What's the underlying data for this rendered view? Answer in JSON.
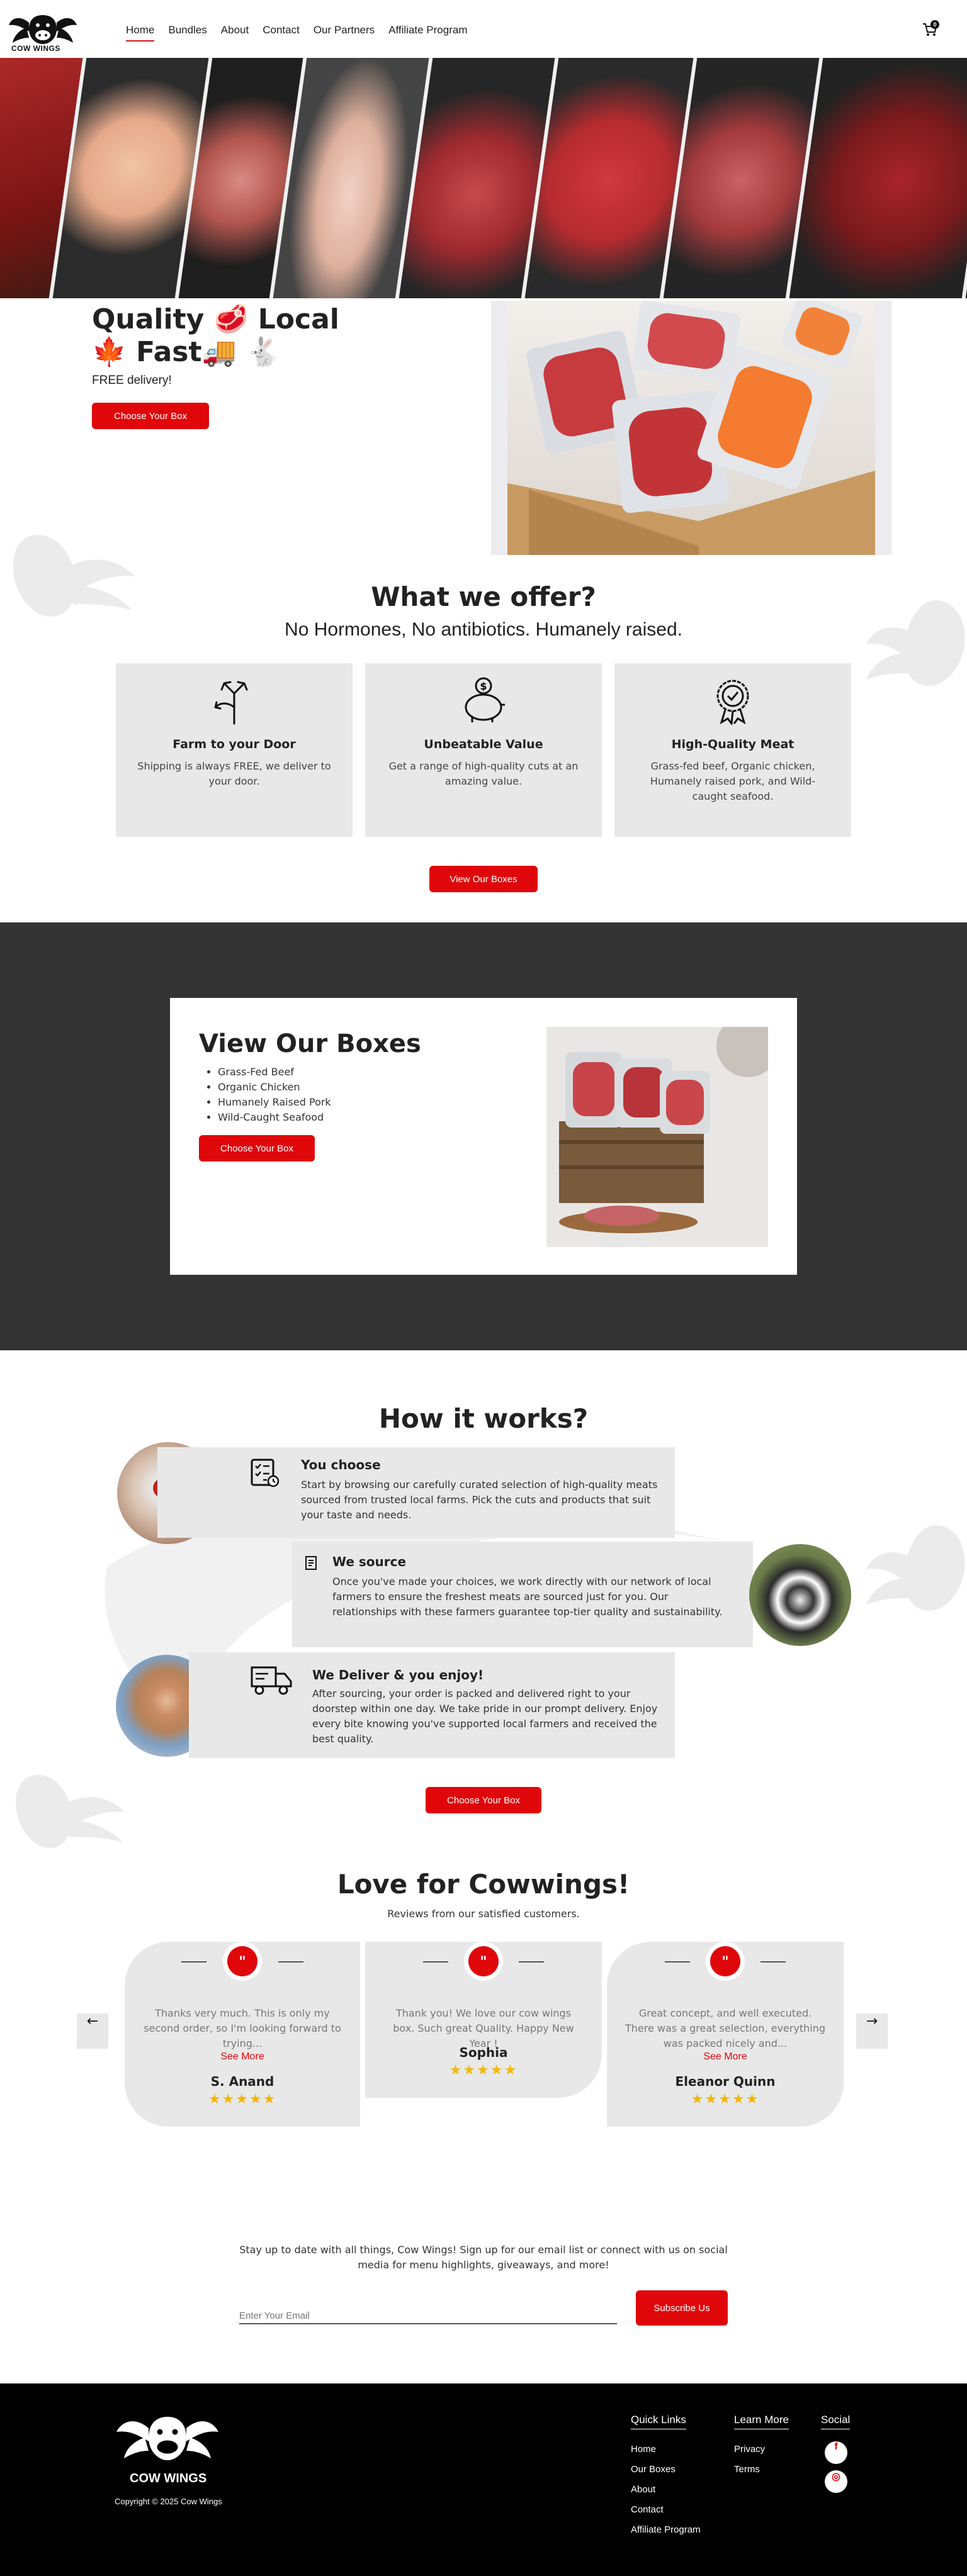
{
  "header": {
    "logo_text": "COW WINGS",
    "nav": [
      "Home",
      "Bundles",
      "About",
      "Contact",
      "Our Partners",
      "Affiliate Program"
    ],
    "cart_count": "0"
  },
  "hero": {
    "title_line1": "Quality 🥩 Local",
    "title_line2": "🍁 Fast🚚 🐇",
    "subtitle": "FREE delivery!",
    "cta": "Choose Your Box"
  },
  "offer": {
    "title": "What we offer?",
    "subtitle": "No Hormones, No antibiotics. Humanely raised.",
    "cards": [
      {
        "icon": "directions-icon",
        "title": "Farm to your Door",
        "text": "Shipping is always FREE, we deliver to your door."
      },
      {
        "icon": "piggy-bank-icon",
        "title": "Unbeatable Value",
        "text": "Get a range of high-quality cuts at an amazing value."
      },
      {
        "icon": "quality-badge-icon",
        "title": "High-Quality Meat",
        "text": "Grass-fed beef, Organic chicken, Humanely raised pork, and Wild-caught seafood."
      }
    ],
    "cta": "View Our Boxes"
  },
  "boxes": {
    "title": "View Our Boxes",
    "items": [
      "Grass-Fed Beef",
      "Organic Chicken",
      "Humanely Raised Pork",
      "Wild-Caught Seafood"
    ],
    "cta": "Choose Your Box"
  },
  "how": {
    "title": "How it works?",
    "steps": [
      {
        "title": "You choose",
        "text": "Start by browsing our carefully curated selection of high-quality meats sourced from trusted local farms. Pick the cuts and products that suit your taste and needs."
      },
      {
        "title": "We source",
        "text": "Once you've made your choices, we work directly with our network of local farmers to ensure the freshest meats are sourced just for you. Our relationships with these farmers guarantee top-tier quality and sustainability."
      },
      {
        "title": "We Deliver & you enjoy!",
        "text": "After sourcing, your order is packed and delivered right to your doorstep within one day. We take pride in our prompt delivery. Enjoy every bite knowing you've supported local farmers and received the best quality."
      }
    ],
    "cta": "Choose Your Box"
  },
  "reviews": {
    "title": "Love for Cowwings!",
    "subtitle": "Reviews from our satisfied customers.",
    "items": [
      {
        "text": "Thanks very much. This is only my second order, so I'm looking forward to trying...",
        "more": "See More",
        "name": "S. Anand",
        "rating": 5
      },
      {
        "text": "Thank you! We love our cow wings box. Such great Quality. Happy New Year !",
        "more": "",
        "name": "Sophia",
        "rating": 5
      },
      {
        "text": "Great concept, and well executed. There was a great selection, everything was packed nicely and...",
        "more": "See More",
        "name": "Eleanor Quinn",
        "rating": 5
      }
    ],
    "stars": "★★★★★",
    "prev": "←",
    "next": "→"
  },
  "newsletter": {
    "text": "Stay up to date with all things, Cow Wings! Sign up for our email list or connect with us on social media for menu highlights, giveaways, and more!",
    "placeholder": "Enter Your Email",
    "cta": "Subscribe Us"
  },
  "footer": {
    "logo_text": "COW WINGS",
    "copyright": "Copyright © 2025 Cow Wings",
    "quick_links_title": "Quick Links",
    "quick_links": [
      "Home",
      "Our Boxes",
      "About",
      "Contact",
      "Affiliate Program"
    ],
    "learn_more_title": "Learn More",
    "learn_more": [
      "Privacy",
      "Terms"
    ],
    "social_title": "Social",
    "social": [
      {
        "icon": "facebook-icon",
        "glyph": "f"
      },
      {
        "icon": "instagram-icon",
        "glyph": "◎"
      }
    ]
  },
  "colors": {
    "accent": "#e0070b",
    "dark": "#333333",
    "card": "#e8e8e8",
    "footer": "#000000",
    "star": "#f2b705"
  }
}
